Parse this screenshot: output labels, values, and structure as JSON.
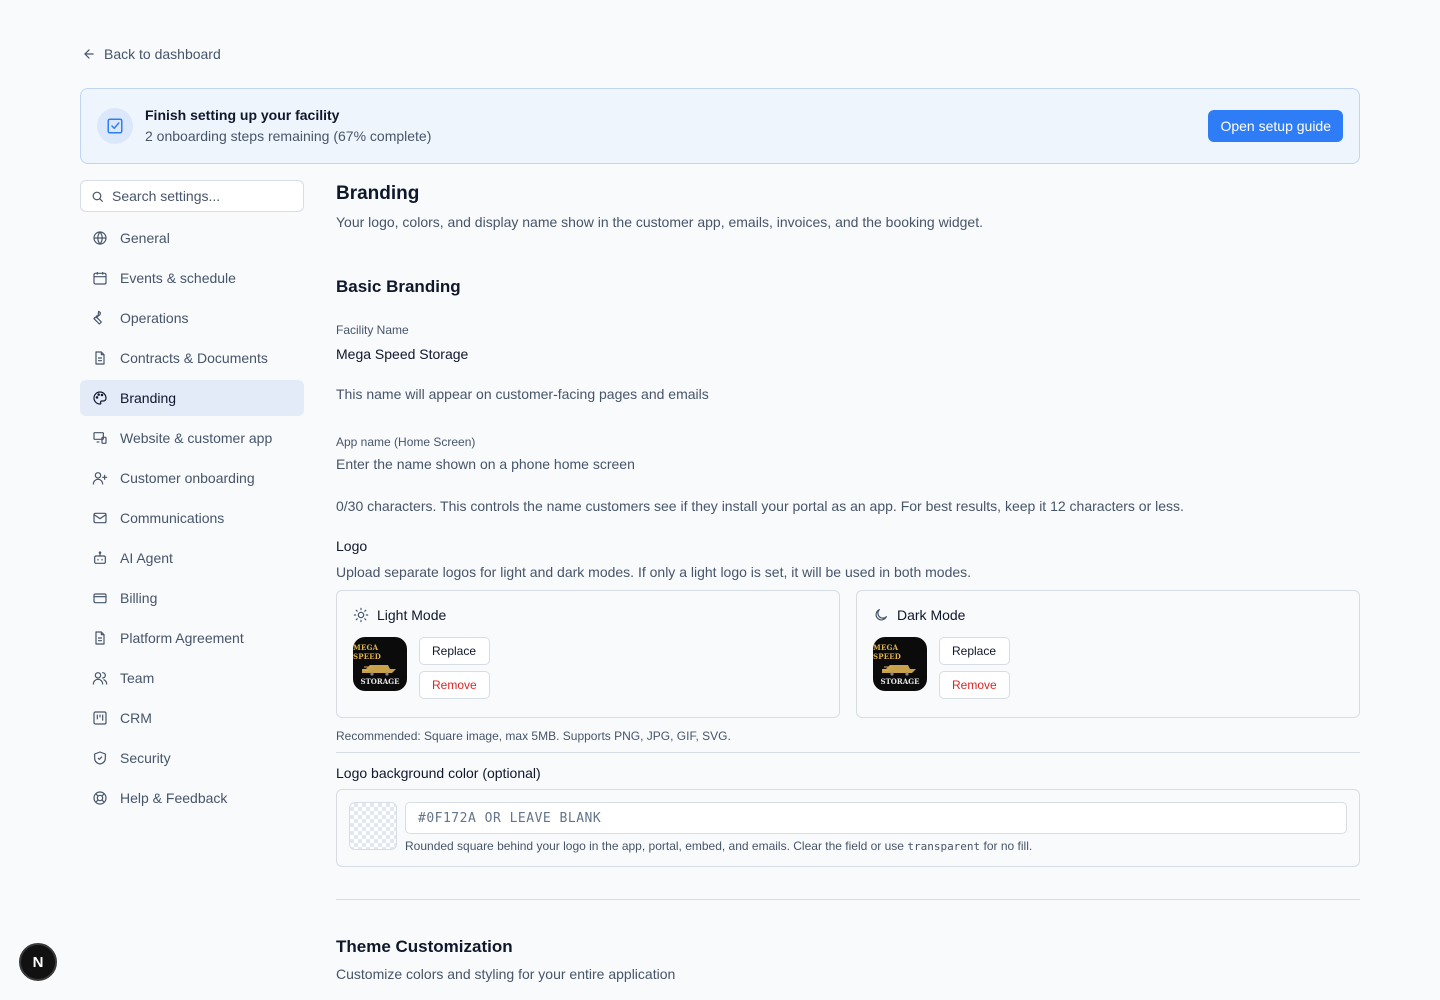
{
  "back_link": {
    "label": "Back to dashboard",
    "icon": "arrow-left-icon"
  },
  "setup": {
    "title": "Finish setting up your facility",
    "subtitle": "2 onboarding steps remaining (67% complete)",
    "button": "Open setup guide",
    "icon": "checkbox-icon"
  },
  "sidebar": {
    "search_placeholder": "Search settings...",
    "items": [
      {
        "label": "General",
        "icon": "globe-icon"
      },
      {
        "label": "Events & schedule",
        "icon": "calendar-icon"
      },
      {
        "label": "Operations",
        "icon": "wrench-icon"
      },
      {
        "label": "Contracts & Documents",
        "icon": "document-icon"
      },
      {
        "label": "Branding",
        "icon": "palette-icon",
        "active": true
      },
      {
        "label": "Website & customer app",
        "icon": "devices-icon"
      },
      {
        "label": "Customer onboarding",
        "icon": "user-plus-icon"
      },
      {
        "label": "Communications",
        "icon": "mail-icon"
      },
      {
        "label": "AI Agent",
        "icon": "bot-icon"
      },
      {
        "label": "Billing",
        "icon": "credit-card-icon"
      },
      {
        "label": "Platform Agreement",
        "icon": "document-icon"
      },
      {
        "label": "Team",
        "icon": "users-icon"
      },
      {
        "label": "CRM",
        "icon": "kanban-icon"
      },
      {
        "label": "Security",
        "icon": "shield-icon"
      },
      {
        "label": "Help & Feedback",
        "icon": "lifebuoy-icon"
      }
    ]
  },
  "main": {
    "title": "Branding",
    "description": "Your logo, colors, and display name show in the customer app, emails, invoices, and the booking widget.",
    "basic": {
      "title": "Basic Branding",
      "facility_label": "Facility Name",
      "facility_value": "Mega Speed Storage",
      "facility_help": "This name will appear on customer-facing pages and emails",
      "app_label": "App name (Home Screen)",
      "app_placeholder": "Enter the name shown on a phone home screen",
      "app_help": "0/30 characters. This controls the name customers see if they install your portal as an app. For best results, keep it 12 characters or less."
    },
    "logo": {
      "label": "Logo",
      "description": "Upload separate logos for light and dark modes. If only a light logo is set, it will be used in both modes.",
      "light": {
        "title": "Light Mode",
        "icon": "sun-icon",
        "replace": "Replace",
        "remove": "Remove"
      },
      "dark": {
        "title": "Dark Mode",
        "icon": "moon-icon",
        "replace": "Replace",
        "remove": "Remove"
      },
      "logo_text_top": "MEGA SPEED",
      "logo_text_bottom": "STORAGE",
      "recommended": "Recommended: Square image, max 5MB. Supports PNG, JPG, GIF, SVG."
    },
    "logo_bg": {
      "label": "Logo background color (optional)",
      "placeholder": "#0F172A OR LEAVE BLANK",
      "help_before": "Rounded square behind your logo in the app, portal, embed, and emails. Clear the field or use",
      "help_code": "transparent",
      "help_after": "for no fill."
    },
    "theme": {
      "title": "Theme Customization",
      "description": "Customize colors and styling for your entire application"
    }
  },
  "badge": {
    "label": "N"
  },
  "colors": {
    "accent": "#2f7df6",
    "danger": "#dc2626",
    "active_bg": "#e3eaf8"
  }
}
